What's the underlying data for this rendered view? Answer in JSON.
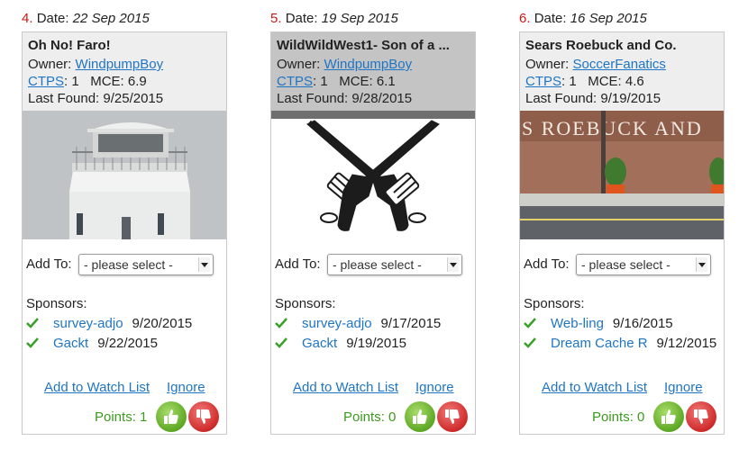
{
  "cards": [
    {
      "number": "4.",
      "date_label": "Date:",
      "date": "22 Sep 2015",
      "title": "Oh No! Faro!",
      "owner_label": "Owner:",
      "owner": "WindpumpBoy",
      "ctps_label": "CTPS",
      "ctps_value": ": 1",
      "mce": "MCE: 6.9",
      "last_found": "Last Found: 9/25/2015",
      "image_icon": "lighthouse-photo",
      "addto_label": "Add To:",
      "select_value": "- please select -",
      "sponsors_label": "Sponsors:",
      "sponsors": [
        {
          "name": "survey-adjo",
          "date": "9/20/2015"
        },
        {
          "name": "Gackt",
          "date": "9/22/2015"
        }
      ],
      "watch_label": "Add to Watch List",
      "ignore_label": "Ignore",
      "points": "Points: 1"
    },
    {
      "number": "5.",
      "date_label": "Date:",
      "date": "19 Sep 2015",
      "title": "WildWildWest1- Son of a ...",
      "owner_label": "Owner:",
      "owner": "WindpumpBoy",
      "ctps_label": "CTPS",
      "ctps_value": ": 1",
      "mce": "MCE: 6.1",
      "last_found": "Last Found: 9/28/2015",
      "image_icon": "crossed-revolvers-image",
      "addto_label": "Add To:",
      "select_value": "- please select -",
      "sponsors_label": "Sponsors:",
      "sponsors": [
        {
          "name": "survey-adjo",
          "date": "9/17/2015"
        },
        {
          "name": "Gackt",
          "date": "9/19/2015"
        }
      ],
      "watch_label": "Add to Watch List",
      "ignore_label": "Ignore",
      "points": "Points: 0"
    },
    {
      "number": "6.",
      "date_label": "Date:",
      "date": "16 Sep 2015",
      "title": "Sears Roebuck and Co.",
      "owner_label": "Owner:",
      "owner": "SoccerFanatics",
      "ctps_label": "CTPS",
      "ctps_value": ": 1",
      "mce": "MCE: 4.6",
      "last_found": "Last Found: 9/19/2015",
      "image_icon": "storefront-photo",
      "image_sign": "S ROEBUCK AND",
      "addto_label": "Add To:",
      "select_value": "- please select -",
      "sponsors_label": "Sponsors:",
      "sponsors": [
        {
          "name": "Web-ling",
          "date": "9/16/2015"
        },
        {
          "name": "Dream Cache R",
          "date": "9/12/2015"
        }
      ],
      "watch_label": "Add to Watch List",
      "ignore_label": "Ignore",
      "points": "Points: 0"
    }
  ],
  "colors": {
    "link": "#1f75c4",
    "number": "#cc1a12",
    "points": "#3c9a1e",
    "check": "#3aa02a",
    "thumb_up": "#5ea824",
    "thumb_down": "#cf2a2a"
  }
}
